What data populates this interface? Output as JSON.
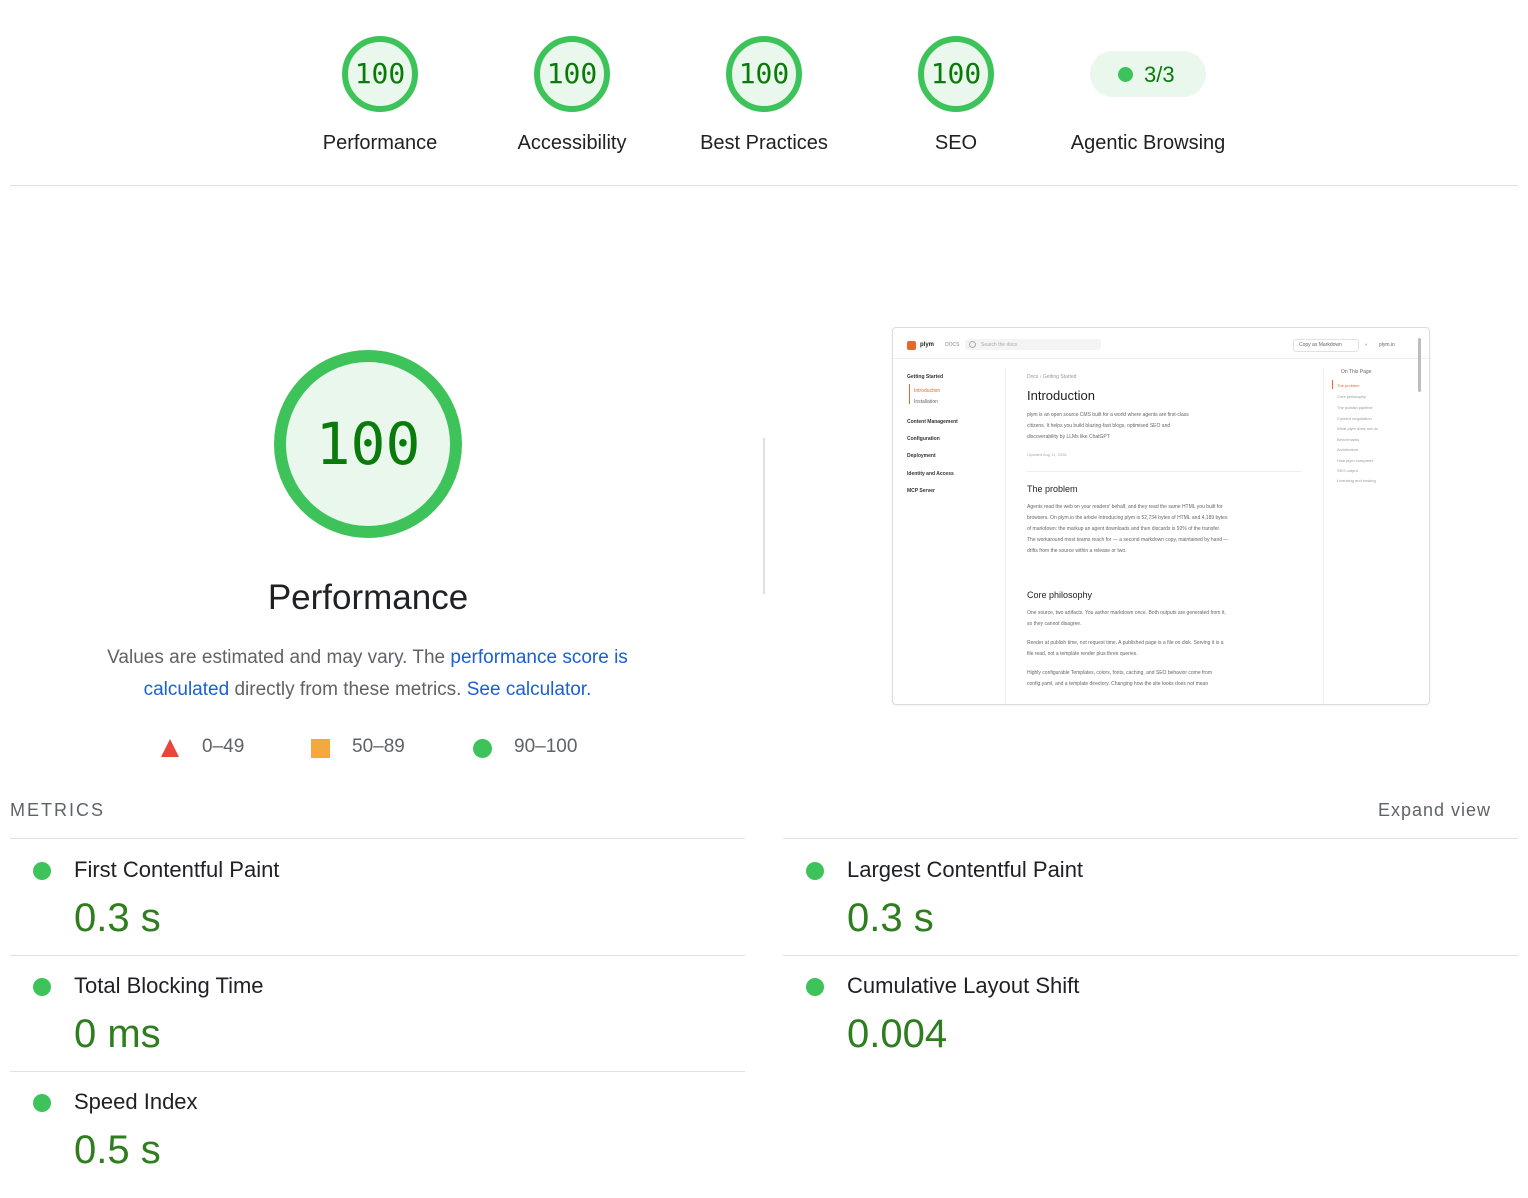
{
  "categories": [
    {
      "name": "Performance",
      "score": "100"
    },
    {
      "name": "Accessibility",
      "score": "100"
    },
    {
      "name": "Best Practices",
      "score": "100"
    },
    {
      "name": "SEO",
      "score": "100"
    },
    {
      "name": "Agentic Browsing",
      "score": "3/3"
    }
  ],
  "main": {
    "score": "100",
    "title": "Performance",
    "desc_part1": "Values are estimated and may vary. The ",
    "desc_link1": "performance score is calculated",
    "desc_part2": " directly from these metrics. ",
    "desc_link2": "See calculator."
  },
  "legend": [
    {
      "range": "0–49",
      "shape": "triangle",
      "color": "#e8453c"
    },
    {
      "range": "50–89",
      "shape": "square",
      "color": "#f5a93c"
    },
    {
      "range": "90–100",
      "shape": "circle",
      "color": "#3ec35a"
    }
  ],
  "screenshot": {
    "logo": "plym",
    "docs": "DOCS",
    "search_placeholder": "Search the docs",
    "copy_button": "Copy as Markdown",
    "site_link": "plym.io",
    "sidebar_sections": [
      "Getting Started",
      "Introduction",
      "Installation",
      "Content Management",
      "Configuration",
      "Deployment",
      "Identity and Access",
      "MCP Server"
    ],
    "breadcrumb": "Docs  ›  Getting Started",
    "heading": "Introduction",
    "intro_lines": [
      "plym is an open source CMS built for a world where agents are first-class",
      "citizens. It helps you build blazing-fast blogs, optimised SEO and",
      "discoverability by LLMs like ChatGPT"
    ],
    "updated": "Updated Aug 11, 2026",
    "h2_problem": "The problem",
    "problem_lines": [
      "Agents read the web on your readers' behalf, and they read the same HTML you built for",
      "browsers. On plym.io the article Introducing plym is 52,734 bytes of HTML and 4,189 bytes",
      "of markdown: the markup an agent downloads and then discards is 92% of the transfer.",
      "The workaround most teams reach for — a second markdown copy, maintained by hand —",
      "drifts from the source within a release or two."
    ],
    "h2_core": "Core philosophy",
    "core_lines": [
      "One source, two artifacts. You author markdown once. Both outputs are generated from it,",
      "so they cannot disagree.",
      "Render at publish time, not request time. A published page is a file on disk. Serving it is a",
      "file read, not a template render plus three queries.",
      "Highly configurable Templates, colors, fonts, caching, and SEO behavior come from",
      "config.yaml, and a template directory. Changing how the site looks does not mean"
    ],
    "toc_title": "On This Page",
    "toc": [
      "The problem",
      "Core philosophy",
      "The publish pipeline",
      "Content negotiation",
      "What plym does not do",
      "Benchmarks",
      "Architecture",
      "How plym compares",
      "SEO output",
      "Licensing and hosting"
    ]
  },
  "metrics": {
    "title": "METRICS",
    "expand": "Expand view",
    "items": [
      {
        "name": "First Contentful Paint",
        "value": "0.3 s"
      },
      {
        "name": "Largest Contentful Paint",
        "value": "0.3 s"
      },
      {
        "name": "Total Blocking Time",
        "value": "0 ms"
      },
      {
        "name": "Cumulative Layout Shift",
        "value": "0.004"
      },
      {
        "name": "Speed Index",
        "value": "0.5 s"
      }
    ]
  },
  "colors": {
    "pass": "#3ec35a",
    "pass_bg": "#e9f7ec",
    "pass_text": "#0a7a0a",
    "metric_value": "#2e7d1f",
    "link": "#1a5fd6"
  }
}
